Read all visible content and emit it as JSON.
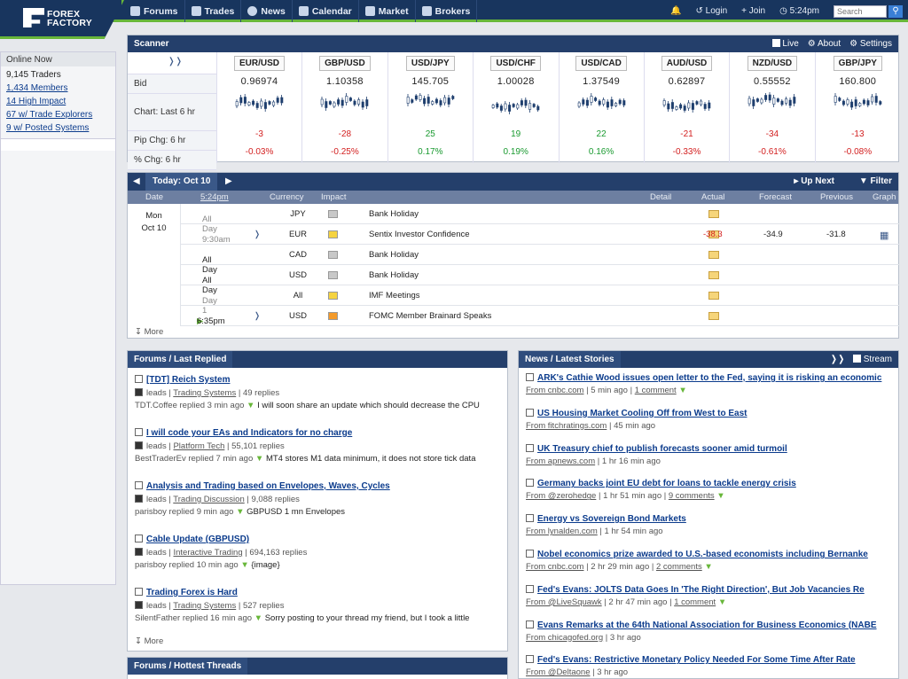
{
  "logo": {
    "line1": "FOREX",
    "line2": "FACTORY"
  },
  "nav": [
    "Forums",
    "Trades",
    "News",
    "Calendar",
    "Market",
    "Brokers"
  ],
  "right_nav": {
    "login": "Login",
    "join": "Join",
    "time": "5:24pm",
    "search_placeholder": "Search"
  },
  "online": {
    "title": "Online Now",
    "items": [
      "9,145 Traders",
      "1,434 Members",
      "14 High Impact",
      "67 w/ Trade Explorers",
      "9 w/ Posted Systems"
    ]
  },
  "scanner": {
    "title": "Scanner",
    "live": "Live",
    "about": "About",
    "settings": "Settings",
    "row_labels": [
      "Bid",
      "Chart: Last 6 hr",
      "Pip Chg: 6 hr",
      "% Chg: 6 hr"
    ],
    "pairs": [
      {
        "name": "EUR/USD",
        "bid": "0.96974",
        "pip": "-3",
        "pct": "-0.03%"
      },
      {
        "name": "GBP/USD",
        "bid": "1.10358",
        "pip": "-28",
        "pct": "-0.25%"
      },
      {
        "name": "USD/JPY",
        "bid": "145.705",
        "pip": "25",
        "pct": "0.17%"
      },
      {
        "name": "USD/CHF",
        "bid": "1.00028",
        "pip": "19",
        "pct": "0.19%"
      },
      {
        "name": "USD/CAD",
        "bid": "1.37549",
        "pip": "22",
        "pct": "0.16%"
      },
      {
        "name": "AUD/USD",
        "bid": "0.62897",
        "pip": "-21",
        "pct": "-0.33%"
      },
      {
        "name": "NZD/USD",
        "bid": "0.55552",
        "pip": "-34",
        "pct": "-0.61%"
      },
      {
        "name": "GBP/JPY",
        "bid": "160.800",
        "pip": "-13",
        "pct": "-0.08%"
      }
    ]
  },
  "calendar": {
    "date_label": "Today: Oct 10",
    "up_next": "Up Next",
    "filter": "Filter",
    "cols": [
      "Date",
      "5:24pm",
      "Currency",
      "Impact",
      "Detail",
      "Actual",
      "Forecast",
      "Previous",
      "Graph"
    ],
    "day": "Mon",
    "day_date": "Oct 10",
    "events": [
      {
        "time": "All Day",
        "cur": "JPY",
        "impact": "gray",
        "name": "Bank Holiday",
        "actual": "",
        "forecast": "",
        "previous": ""
      },
      {
        "time": "9:30am",
        "cur": "EUR",
        "impact": "yellow",
        "name": "Sentix Investor Confidence",
        "actual": "-38.3",
        "forecast": "-34.9",
        "previous": "-31.8"
      },
      {
        "time": "All Day",
        "cur": "CAD",
        "impact": "gray",
        "name": "Bank Holiday",
        "actual": "",
        "forecast": "",
        "previous": ""
      },
      {
        "time": "All Day",
        "cur": "USD",
        "impact": "gray",
        "name": "Bank Holiday",
        "actual": "",
        "forecast": "",
        "previous": ""
      },
      {
        "time": "Day 1",
        "cur": "All",
        "impact": "yellow",
        "name": "IMF Meetings",
        "actual": "",
        "forecast": "",
        "previous": ""
      },
      {
        "time": "6:35pm",
        "cur": "USD",
        "impact": "orange",
        "name": "FOMC Member Brainard Speaks",
        "actual": "",
        "forecast": "",
        "previous": ""
      }
    ],
    "more": "More"
  },
  "forums": {
    "title": "Forums / Last Replied",
    "threads": [
      {
        "title": "[TDT] Reich System",
        "leads": "leads",
        "forum": "Trading Systems",
        "replies": "49 replies",
        "who": "TDT.Coffee replied 3 min ago",
        "snippet": "I will soon share an update which should decrease the CPU"
      },
      {
        "title": "I will code your EAs and Indicators for no charge",
        "leads": "leads",
        "forum": "Platform Tech",
        "replies": "55,101 replies",
        "who": "BestTraderEv replied 7 min ago",
        "snippet": "MT4 stores M1 data minimum, it does not store tick data"
      },
      {
        "title": "Analysis and Trading based on Envelopes, Waves, Cycles",
        "leads": "leads",
        "forum": "Trading Discussion",
        "replies": "9,088 replies",
        "who": "parisboy replied 9 min ago",
        "snippet": "GBPUSD 1 mn Envelopes"
      },
      {
        "title": "Cable Update (GBPUSD)",
        "leads": "leads",
        "forum": "Interactive Trading",
        "replies": "694,163 replies",
        "who": "parisboy replied 10 min ago",
        "snippet": "{image}"
      },
      {
        "title": "Trading Forex is Hard",
        "leads": "leads",
        "forum": "Trading Systems",
        "replies": "527 replies",
        "who": "SilentFather replied 16 min ago",
        "snippet": "Sorry posting to your thread my friend, but I took a little"
      }
    ],
    "more": "More"
  },
  "hottest": {
    "title": "Forums / Hottest Threads"
  },
  "news": {
    "title": "News / Latest Stories",
    "stream": "Stream",
    "stories": [
      {
        "title": "ARK's Cathie Wood issues open letter to the Fed, saying it is risking an economic",
        "from": "From cnbc.com",
        "ago": "5 min ago",
        "comments": "1 comment"
      },
      {
        "title": "US Housing Market Cooling Off from West to East",
        "from": "From fitchratings.com",
        "ago": "45 min ago",
        "comments": ""
      },
      {
        "title": "UK Treasury chief to publish forecasts sooner amid turmoil",
        "from": "From apnews.com",
        "ago": "1 hr 16 min ago",
        "comments": ""
      },
      {
        "title": "Germany backs joint EU debt for loans to tackle energy crisis",
        "from": "From @zerohedge",
        "ago": "1 hr 51 min ago",
        "comments": "9 comments"
      },
      {
        "title": "Energy vs Sovereign Bond Markets",
        "from": "From lynalden.com",
        "ago": "1 hr 54 min ago",
        "comments": ""
      },
      {
        "title": "Nobel economics prize awarded to U.S.-based economists including Bernanke",
        "from": "From cnbc.com",
        "ago": "2 hr 29 min ago",
        "comments": "2 comments"
      },
      {
        "title": "Fed's Evans: JOLTS Data Goes In 'The Right Direction', But Job Vacancies Re",
        "from": "From @LiveSquawk",
        "ago": "2 hr 47 min ago",
        "comments": "1 comment"
      },
      {
        "title": "Evans Remarks at the 64th National Association for Business Economics (NABE",
        "from": "From chicagofed.org",
        "ago": "3 hr ago",
        "comments": ""
      },
      {
        "title": "Fed's Evans: Restrictive Monetary Policy Needed For Some Time After Rate",
        "from": "From @Deltaone",
        "ago": "3 hr ago",
        "comments": ""
      }
    ]
  },
  "colors": {
    "navy": "#18355e",
    "green": "#68b73a",
    "neg": "#d32020",
    "pos": "#1a9a30"
  }
}
